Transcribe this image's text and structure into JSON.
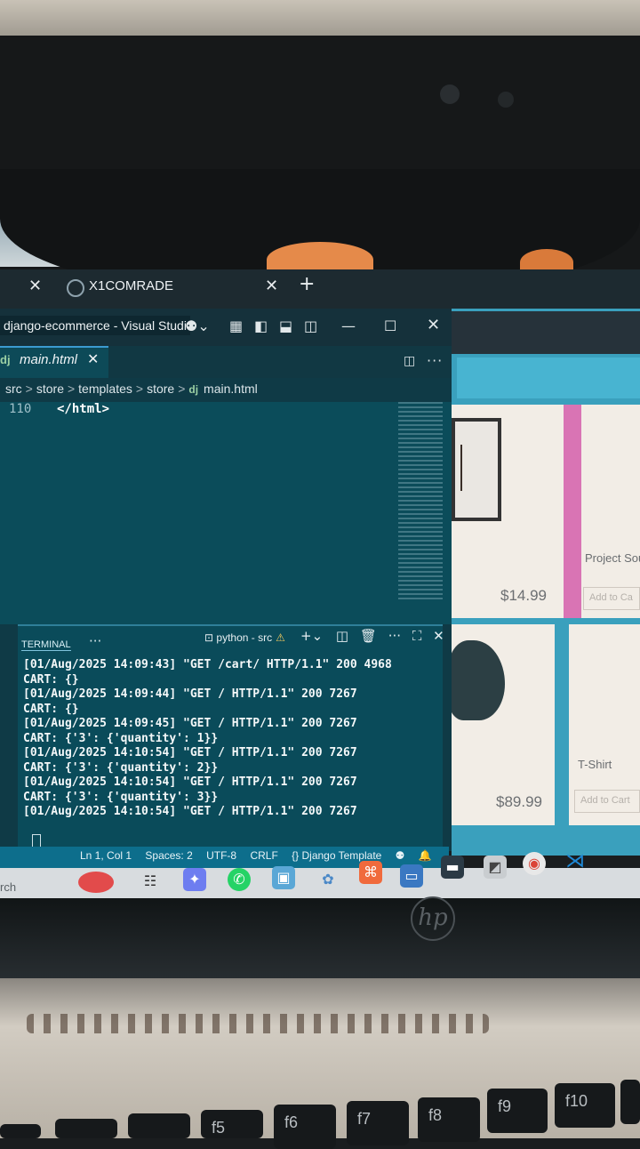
{
  "browser_tab": {
    "title": "X1COMRADE"
  },
  "window": {
    "title": "django-ecommerce - Visual Studi"
  },
  "editor": {
    "tab": {
      "prefix": "dj",
      "filename": "main.html"
    },
    "breadcrumb": [
      "src",
      "store",
      "templates",
      "store",
      "main.html"
    ],
    "breadcrumb_prefix": "dj",
    "lines": [
      {
        "number": "110",
        "code": "</html>"
      }
    ]
  },
  "terminal": {
    "label": "TERMINAL",
    "profile": "python - src",
    "lines": [
      "[01/Aug/2025 14:09:43] \"GET /cart/ HTTP/1.1\" 200 4968",
      "CART: {}",
      "[01/Aug/2025 14:09:44] \"GET / HTTP/1.1\" 200 7267",
      "CART: {}",
      "[01/Aug/2025 14:09:45] \"GET / HTTP/1.1\" 200 7267",
      "CART: {'3': {'quantity': 1}}",
      "[01/Aug/2025 14:10:54] \"GET / HTTP/1.1\" 200 7267",
      "CART: {'3': {'quantity': 2}}",
      "[01/Aug/2025 14:10:54] \"GET / HTTP/1.1\" 200 7267",
      "CART: {'3': {'quantity': 3}}",
      "[01/Aug/2025 14:10:54] \"GET / HTTP/1.1\" 200 7267"
    ]
  },
  "statusbar": {
    "position": "Ln 1, Col 1",
    "spaces": "Spaces: 2",
    "encoding": "UTF-8",
    "eol": "CRLF",
    "language": "{} Django Template"
  },
  "taskbar": {
    "search": "rch"
  },
  "store": {
    "products": [
      {
        "name": "",
        "price": "$14.99",
        "button": ""
      },
      {
        "name": "Project Sou",
        "price": "",
        "button": "Add to Ca"
      },
      {
        "name": "",
        "price": "$89.99",
        "button": ""
      },
      {
        "name": "T-Shirt",
        "price": "",
        "button": "Add to Cart"
      }
    ]
  },
  "keyboard": {
    "keys": [
      "f5",
      "f6",
      "f7",
      "f8",
      "f9",
      "f10"
    ]
  },
  "laptop": {
    "brand": "hp"
  },
  "colors": {
    "editor_bg": "#0b4c5a",
    "terminal_bg": "#0a4b5a",
    "statusbar": "#0d6e8c",
    "browser_accent": "#3aa0bd"
  }
}
